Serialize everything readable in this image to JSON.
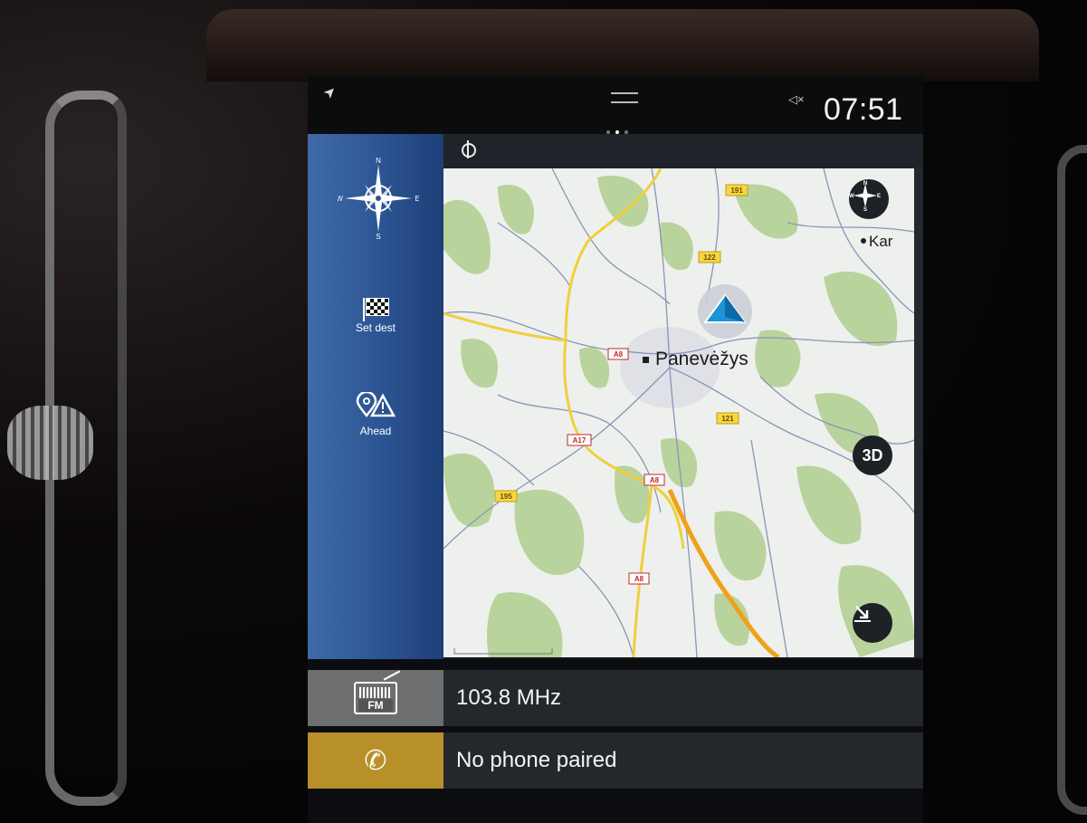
{
  "status": {
    "time": "07:51",
    "page_indicator": {
      "count": 3,
      "active": 2
    }
  },
  "nav_sidebar": {
    "compass": {
      "n": "N",
      "s": "S",
      "e": "E",
      "w": "W"
    },
    "set_dest_label": "Set dest",
    "ahead_label": "Ahead"
  },
  "map": {
    "city_label": "Panevėžys",
    "edge_city_label": "Kar",
    "road_labels": [
      "191",
      "122",
      "A8",
      "A17",
      "A8",
      "121",
      "195",
      "A8"
    ],
    "button_3d_label": "3D",
    "mini_compass": {
      "n": "N",
      "s": "S",
      "e": "E",
      "w": "W"
    }
  },
  "tiles": {
    "radio": {
      "text": "103.8 MHz",
      "icon_label": "FM"
    },
    "phone": {
      "text": "No phone paired"
    }
  },
  "colors": {
    "sidebar_blue": "#2c5493",
    "phone_accent": "#b8902a",
    "radio_accent": "#6d6e70",
    "road_yellow": "#f0cf3c",
    "road_orange": "#efa11a",
    "forest_green": "#b9d39c"
  }
}
